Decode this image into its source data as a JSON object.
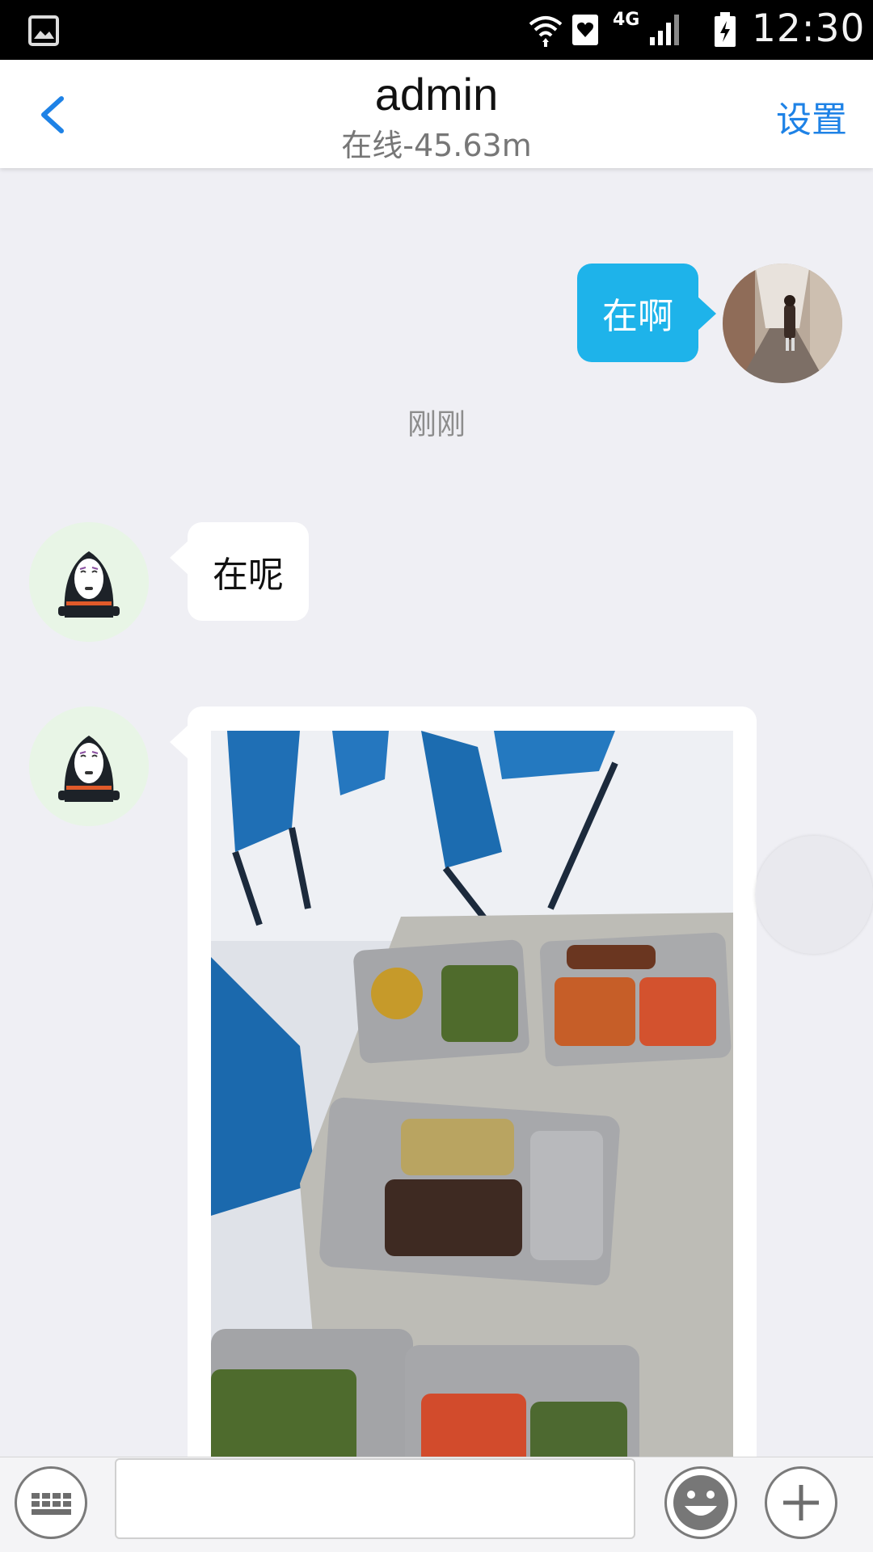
{
  "status_bar": {
    "time": "12:30",
    "network": "4G",
    "icons": [
      "gallery-icon",
      "wifi-icon",
      "heart-icon",
      "signal-icon",
      "battery-icon"
    ]
  },
  "header": {
    "back_icon": "chevron-left-icon",
    "title": "admin",
    "subtitle": "在线-45.63m",
    "settings_label": "设置"
  },
  "messages": [
    {
      "direction": "outgoing",
      "text": "在啊",
      "avatar": "user-photo-avatar"
    },
    {
      "type": "timestamp",
      "text": "刚刚"
    },
    {
      "direction": "incoming",
      "text": "在呢",
      "avatar": "no-face-avatar"
    },
    {
      "direction": "incoming",
      "type": "image",
      "content": "cafeteria food trays photo",
      "avatar": "no-face-avatar"
    }
  ],
  "input_bar": {
    "keyboard_icon": "keyboard-icon",
    "text_value": "",
    "emoji_icon": "emoji-icon",
    "plus_icon": "plus-icon"
  },
  "colors": {
    "accent": "#1e82e6",
    "outgoing_bubble": "#1eb3ea",
    "background": "#efeff4"
  }
}
